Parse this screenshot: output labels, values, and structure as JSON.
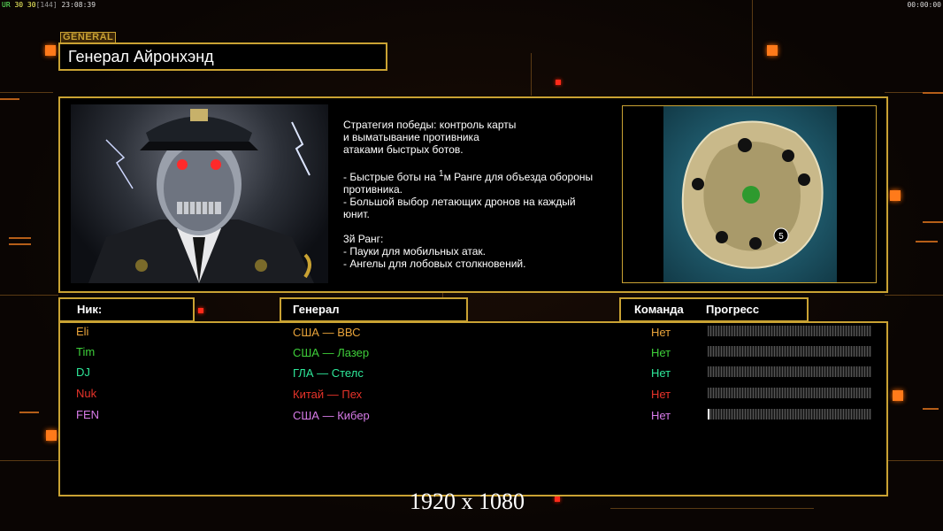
{
  "topbar": {
    "left_prefix": "UR",
    "left_values": "30 30",
    "left_bracket": "[144]",
    "left_time": "23:08:39",
    "right_time": "00:00:00"
  },
  "general_tag": "GENERAL",
  "general_name": "Генерал Айронхэнд",
  "description": {
    "line1": "Стратегия победы: контроль карты",
    "line2": "и выматывание противника",
    "line3": "атаками быстрых ботов.",
    "line4a": "- Быстрые боты на ",
    "line4b": "1",
    "line4c": "м Ранге для объезда обороны",
    "line5": "  противника.",
    "line6": "- Большой выбор летающих дронов на каждый",
    "line7": "  юнит.",
    "line8a": "3",
    "line8b": "й Ранг:",
    "line9": "- Пауки для мобильных атак.",
    "line10": "- Ангелы для лобовых столкновений."
  },
  "map": {
    "player_marker": "5"
  },
  "headers": {
    "nick": "Ник:",
    "general": "Генерал",
    "team": "Команда",
    "progress": "Прогресс"
  },
  "players": [
    {
      "nick": "Eli",
      "general": "США — ВВС",
      "team": "Нет",
      "color": "#e8a33a",
      "progress": 0
    },
    {
      "nick": "Tim",
      "general": "США — Лазер",
      "team": "Нет",
      "color": "#3ecf3a",
      "progress": 0
    },
    {
      "nick": "DJ",
      "general": "ГЛА — Стелс",
      "team": "Нет",
      "color": "#2ee89a",
      "progress": 0
    },
    {
      "nick": "Nuk",
      "general": "Китай — Пех",
      "team": "Нет",
      "color": "#e8332a",
      "progress": 0
    },
    {
      "nick": "FEN",
      "general": "США — Кибер",
      "team": "Нет",
      "color": "#d77be8",
      "progress": 0.01
    }
  ],
  "resolution": "1920 x 1080",
  "colors": {
    "accent": "#c9a233",
    "glow": "#ff7a1a"
  }
}
